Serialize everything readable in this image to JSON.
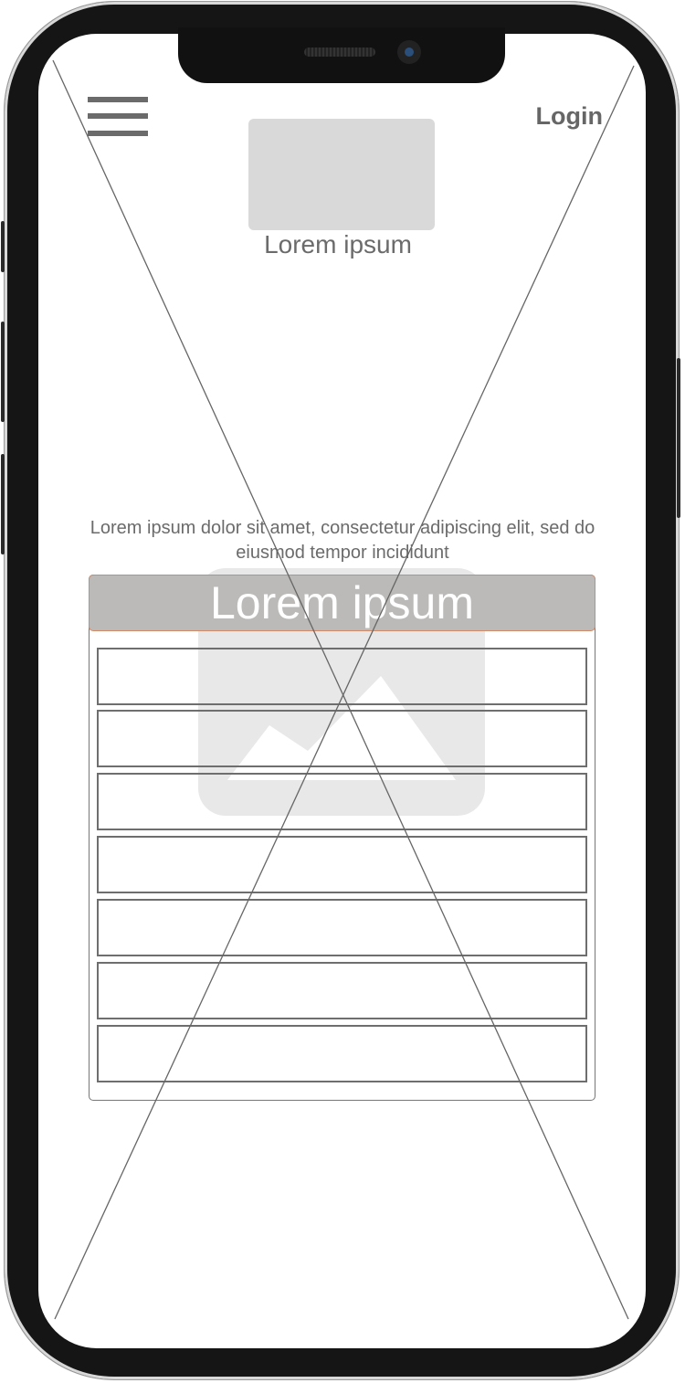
{
  "header": {
    "login_label": "Login",
    "logo_caption": "Lorem ipsum"
  },
  "main": {
    "paragraph": "Lorem ipsum dolor sit amet, consectetur adipiscing elit, sed do eiusmod tempor incididunt",
    "table": {
      "title": "Lorem ipsum",
      "rows": [
        "",
        "",
        "",
        "",
        "",
        "",
        ""
      ]
    }
  },
  "colors": {
    "header_bg": "#bbbab8",
    "header_border": "#d08a6a",
    "placeholder": "#d9d9d9"
  }
}
